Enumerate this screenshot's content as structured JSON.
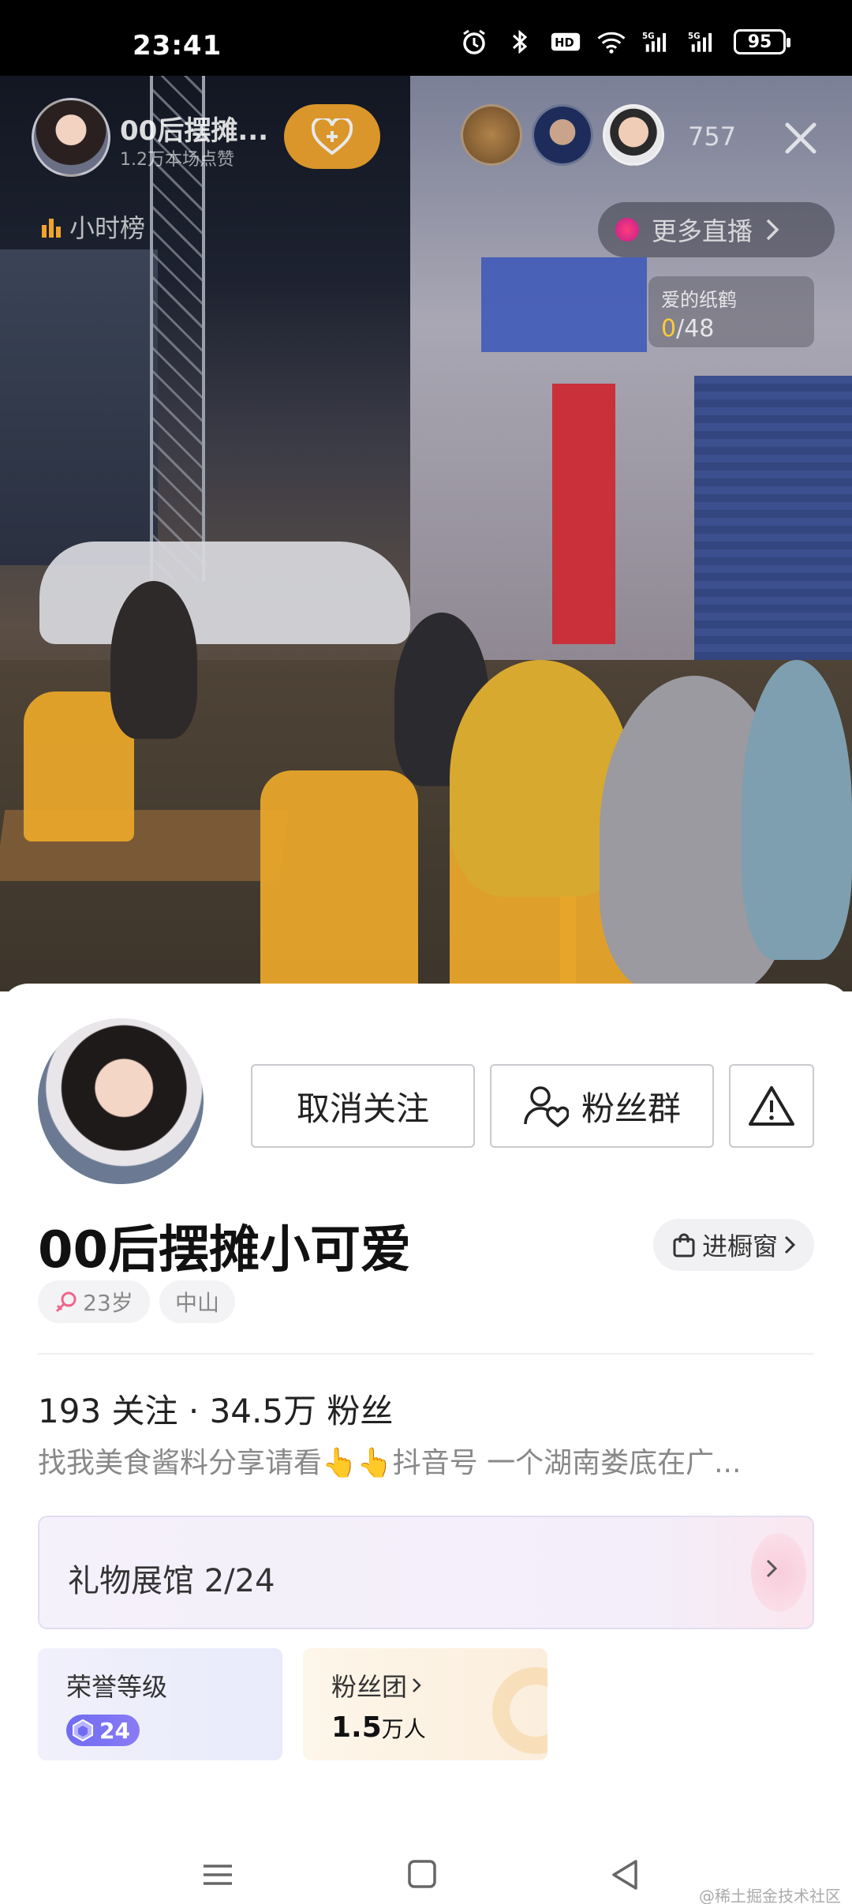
{
  "status_bar": {
    "time": "23:41",
    "battery": "95",
    "icons": [
      "alarm-icon",
      "bluetooth-icon",
      "hd-icon",
      "wifi-icon",
      "5g-signal-icon",
      "5g-signal-icon"
    ]
  },
  "live": {
    "host_name": "00后摆摊...",
    "host_likes": "1.2万本场点赞",
    "viewer_count": "757",
    "hour_rank_label": "小时榜",
    "more_live_label": "更多直播",
    "crane_card": {
      "title": "爱的纸鹤",
      "progress_current": "0",
      "progress_total": "/48"
    }
  },
  "profile": {
    "unfollow_label": "取消关注",
    "fans_group_label": "粉丝群",
    "nickname": "00后摆摊小可爱",
    "shop_label": "进橱窗",
    "age_tag": "23岁",
    "city_tag": "中山",
    "stats": "193 关注 · 34.5万 粉丝",
    "bio": "找我美食酱料分享请看👆👆抖音号 一个湖南娄底在广...",
    "gift_hall_label": "礼物展馆 2/24",
    "honor_level_title": "荣誉等级",
    "honor_level_value": "24",
    "fans_club_title": "粉丝团",
    "fans_club_count": "1.5",
    "fans_club_unit": "万人"
  },
  "watermark": "@稀土掘金技术社区",
  "colors": {
    "accent_orange": "#f0a42b",
    "level_purple": "#6f6cf2",
    "crane_highlight": "#ffcc33"
  }
}
